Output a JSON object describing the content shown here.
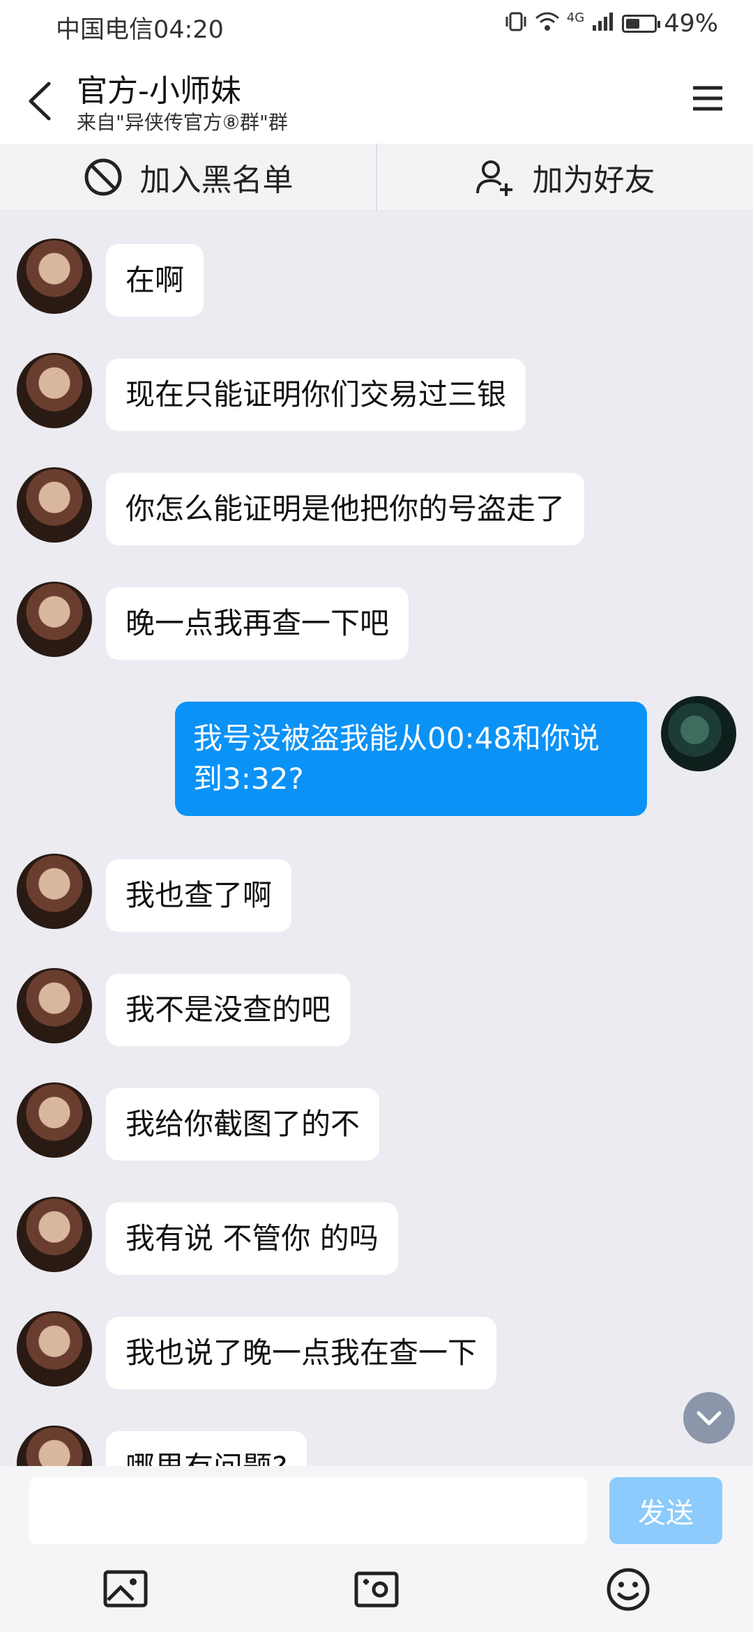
{
  "status_bar": {
    "carrier_time": "中国电信04:20",
    "network": "4G",
    "battery": "49%",
    "battery_level": 0.49
  },
  "header": {
    "title": "官方-小师妹",
    "subtitle": "来自\"异侠传官方⑧群\"群"
  },
  "actions": {
    "blacklist_label": "加入黑名单",
    "add_friend_label": "加为好友"
  },
  "messages": [
    {
      "from": "other",
      "text": "在啊"
    },
    {
      "from": "other",
      "text": "现在只能证明你们交易过三银"
    },
    {
      "from": "other",
      "text": "你怎么能证明是他把你的号盗走了"
    },
    {
      "from": "other",
      "text": "晚一点我再查一下吧"
    },
    {
      "from": "me",
      "text": "我号没被盗我能从00:48和你说到3:32?"
    },
    {
      "from": "other",
      "text": "我也查了啊"
    },
    {
      "from": "other",
      "text": "我不是没查的吧"
    },
    {
      "from": "other",
      "text": "我给你截图了的不"
    },
    {
      "from": "other",
      "text": "我有说 不管你 的吗"
    },
    {
      "from": "other",
      "text": "我也说了晚一点我在查一下"
    },
    {
      "from": "other",
      "text": "哪里有问题?"
    }
  ],
  "composer": {
    "send_label": "发送"
  },
  "colors": {
    "accent": "#0b92f7",
    "send_disabled": "#8ccbfb",
    "background": "#ebebf1"
  },
  "icons": [
    "back-arrow-icon",
    "menu-icon",
    "block-icon",
    "add-friend-icon",
    "chevron-down-icon",
    "image-icon",
    "camera-icon",
    "emoji-icon"
  ]
}
